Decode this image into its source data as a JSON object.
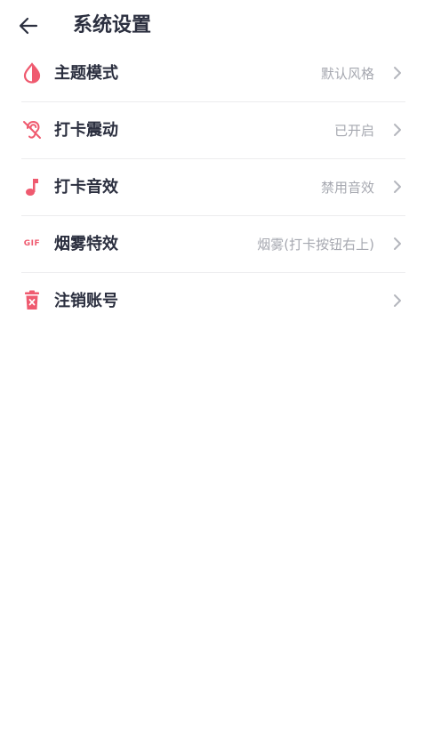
{
  "header": {
    "title": "系统设置",
    "back_icon": "arrow-left-icon"
  },
  "colors": {
    "accent": "#ef5a6f",
    "text": "#2b2f3f",
    "secondary_text": "#a6a8b0",
    "divider": "#ececee"
  },
  "settings": {
    "items": [
      {
        "label": "主题模式",
        "value": "默认风格",
        "icon": "drop-icon"
      },
      {
        "label": "打卡震动",
        "value": "已开启",
        "icon": "ear-off-icon"
      },
      {
        "label": "打卡音效",
        "value": "禁用音效",
        "icon": "music-note-icon"
      },
      {
        "label": "烟雾特效",
        "value": "烟雾(打卡按钮右上)",
        "icon": "gif-icon",
        "icon_text": "GIF"
      },
      {
        "label": "注销账号",
        "value": "",
        "icon": "trash-icon"
      }
    ]
  }
}
